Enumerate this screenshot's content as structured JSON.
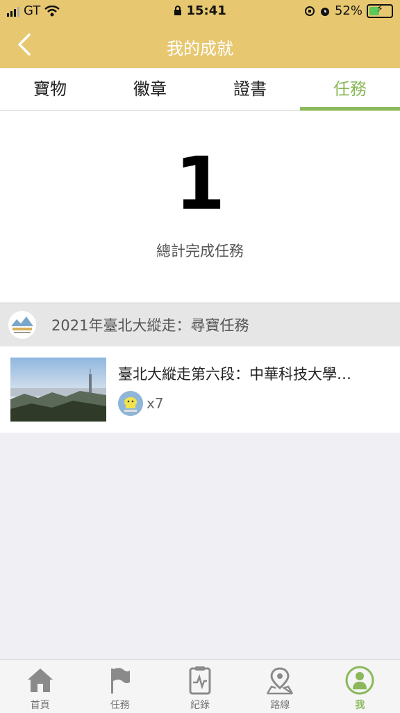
{
  "status_bar": {
    "carrier": "GT",
    "time": "15:41",
    "battery": "52%",
    "battery_level": 0.52
  },
  "header": {
    "title": "我的成就"
  },
  "tabs": [
    {
      "label": "寶物",
      "active": false
    },
    {
      "label": "徽章",
      "active": false
    },
    {
      "label": "證書",
      "active": false
    },
    {
      "label": "任務",
      "active": true
    }
  ],
  "summary": {
    "count": "1",
    "label": "總計完成任務"
  },
  "group": {
    "name": "2021年臺北大縱走：尋寶任務"
  },
  "task": {
    "title": "臺北大縱走第六段：中華科技大學…",
    "count": "x7"
  },
  "bottom_nav": [
    {
      "label": "首頁",
      "icon": "home-icon",
      "active": false
    },
    {
      "label": "任務",
      "icon": "flag-icon",
      "active": false
    },
    {
      "label": "紀錄",
      "icon": "clipboard-icon",
      "active": false
    },
    {
      "label": "路線",
      "icon": "map-pin-icon",
      "active": false
    },
    {
      "label": "我",
      "icon": "user-icon",
      "active": true
    }
  ],
  "colors": {
    "accent": "#8ab85a",
    "header": "#e7c770",
    "background": "#efeff4"
  }
}
